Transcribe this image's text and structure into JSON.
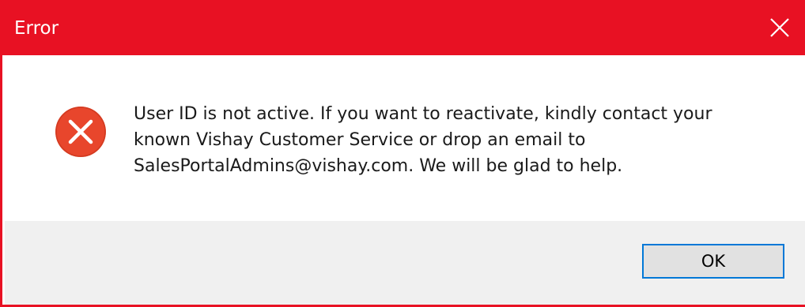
{
  "window": {
    "title": "Error",
    "close_icon": "close-icon",
    "accent_color": "#e81123"
  },
  "content": {
    "icon": "error-icon",
    "message": "User ID is not active. If you want to reactivate, kindly contact your known Vishay Customer Service or drop an email to SalesPortalAdmins@vishay.com. We will be glad to help."
  },
  "footer": {
    "ok_label": "OK",
    "focus_color": "#0078d7"
  }
}
